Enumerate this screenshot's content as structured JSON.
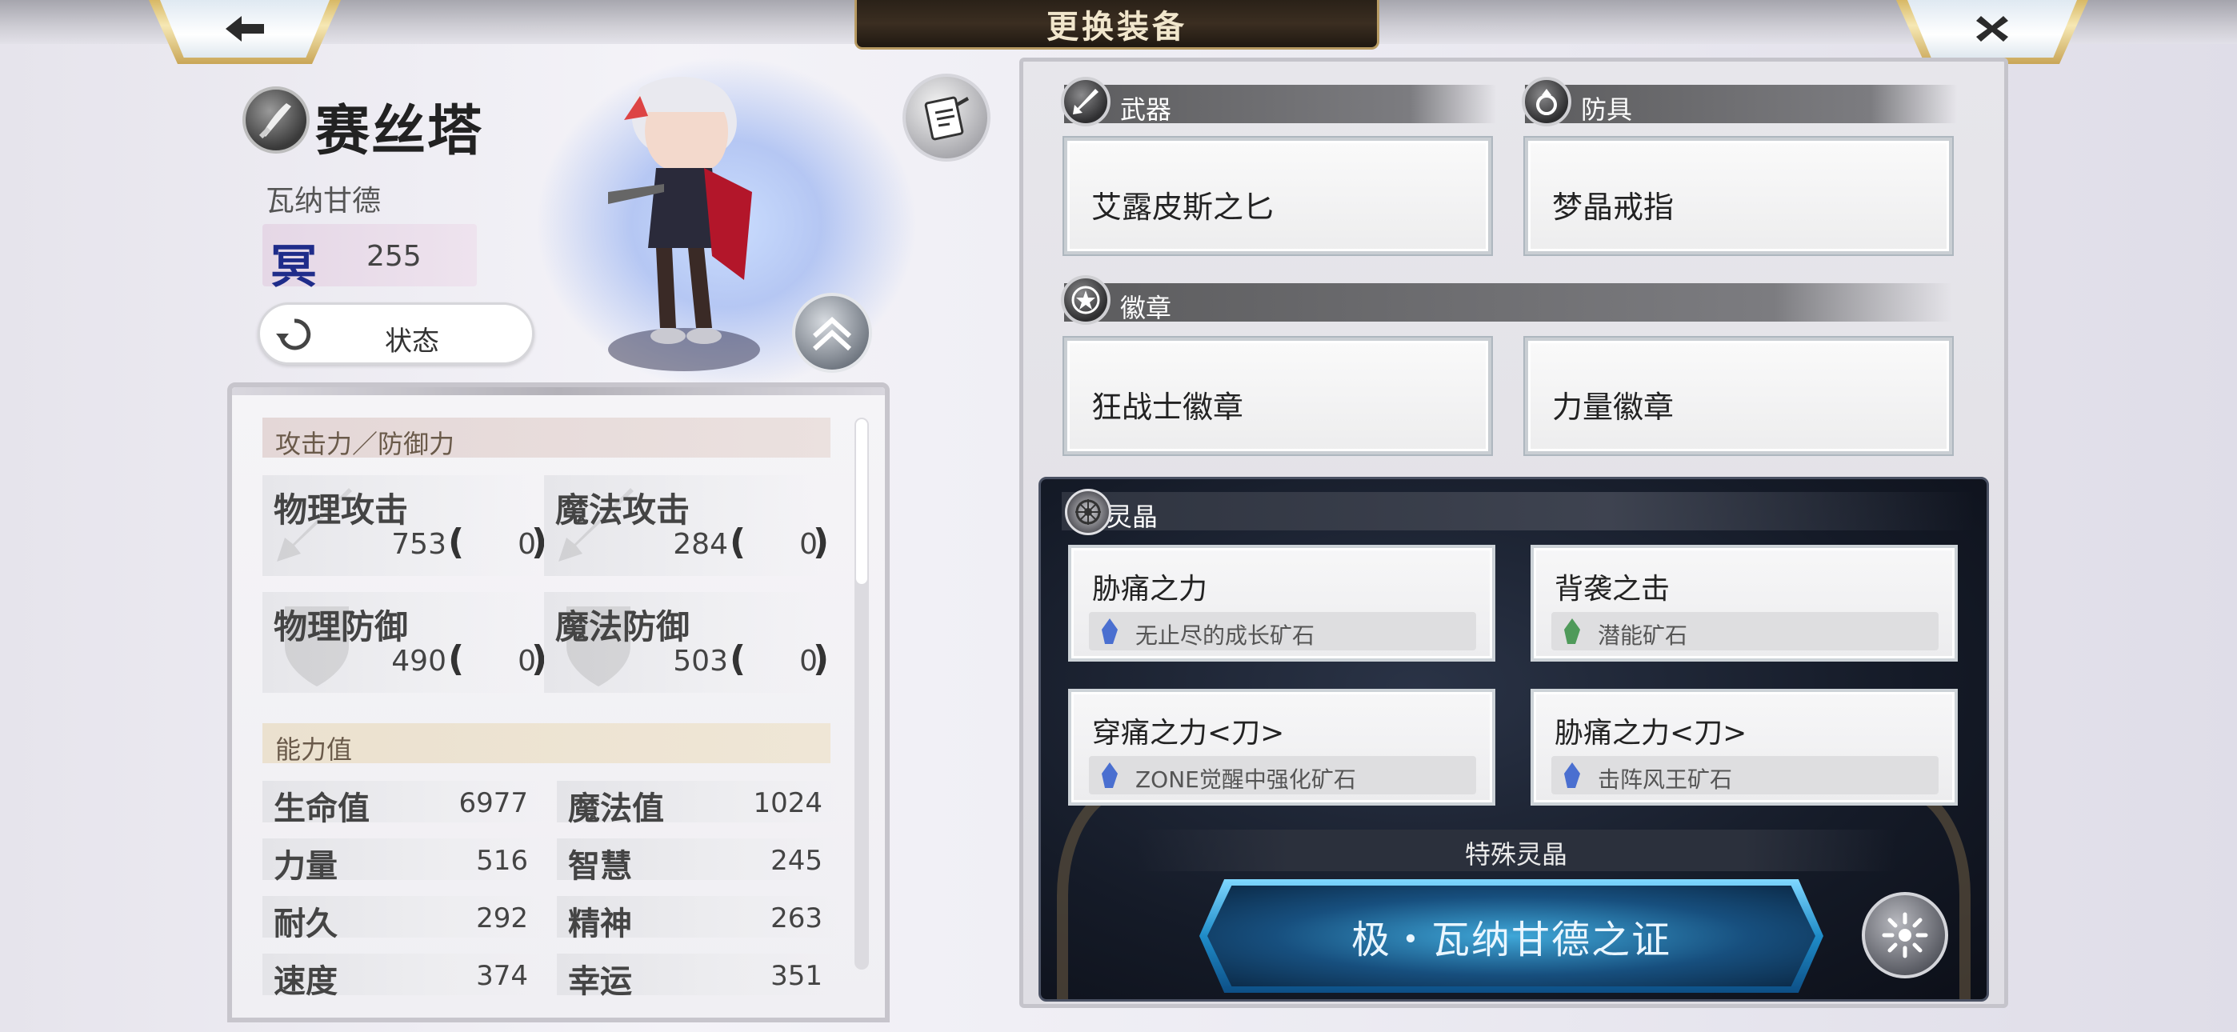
{
  "header": {
    "title": "更换装备",
    "back_icon": "back-arrow-icon",
    "close_icon": "close-icon"
  },
  "character": {
    "name": "赛丝塔",
    "affiliation": "瓦纳甘德",
    "level_glyph": "冥",
    "level": "255",
    "status_button": "状态"
  },
  "stats": {
    "section_attack": "攻击力／防御力",
    "attack": [
      {
        "name": "物理攻击",
        "value": "753",
        "bonus": "0"
      },
      {
        "name": "魔法攻击",
        "value": "284",
        "bonus": "0"
      },
      {
        "name": "物理防御",
        "value": "490",
        "bonus": "0"
      },
      {
        "name": "魔法防御",
        "value": "503",
        "bonus": "0"
      }
    ],
    "section_ability": "能力值",
    "ability": [
      {
        "name": "生命值",
        "value": "6977"
      },
      {
        "name": "魔法值",
        "value": "1024"
      },
      {
        "name": "力量",
        "value": "516"
      },
      {
        "name": "智慧",
        "value": "245"
      },
      {
        "name": "耐久",
        "value": "292"
      },
      {
        "name": "精神",
        "value": "263"
      },
      {
        "name": "速度",
        "value": "374"
      },
      {
        "name": "幸运",
        "value": "351"
      }
    ]
  },
  "equipment": {
    "weapon": {
      "label": "武器",
      "item": "艾露皮斯之匕"
    },
    "armor": {
      "label": "防具",
      "item": "梦晶戒指"
    },
    "badge": {
      "label": "徽章",
      "items": [
        "狂战士徽章",
        "力量徽章"
      ]
    }
  },
  "crystals": {
    "label": "灵晶",
    "slots": [
      {
        "name": "胁痛之力",
        "ore": "无止尽的成长矿石",
        "ore_color": "#4a6fd0"
      },
      {
        "name": "背袭之击",
        "ore": "潜能矿石",
        "ore_color": "#4f9a5a"
      },
      {
        "name": "穿痛之力<刀>",
        "ore": "ZONE觉醒中强化矿石",
        "ore_color": "#4a6fd0"
      },
      {
        "name": "胁痛之力<刀>",
        "ore": "击阵风王矿石",
        "ore_color": "#4a6fd0"
      }
    ],
    "special_label": "特殊灵晶",
    "special_item": "极・瓦纳甘德之证"
  },
  "colors": {
    "title_gold": "#b79a62",
    "level_glyph": "#1f2c8a",
    "special_blue": "#1f8cc8"
  }
}
